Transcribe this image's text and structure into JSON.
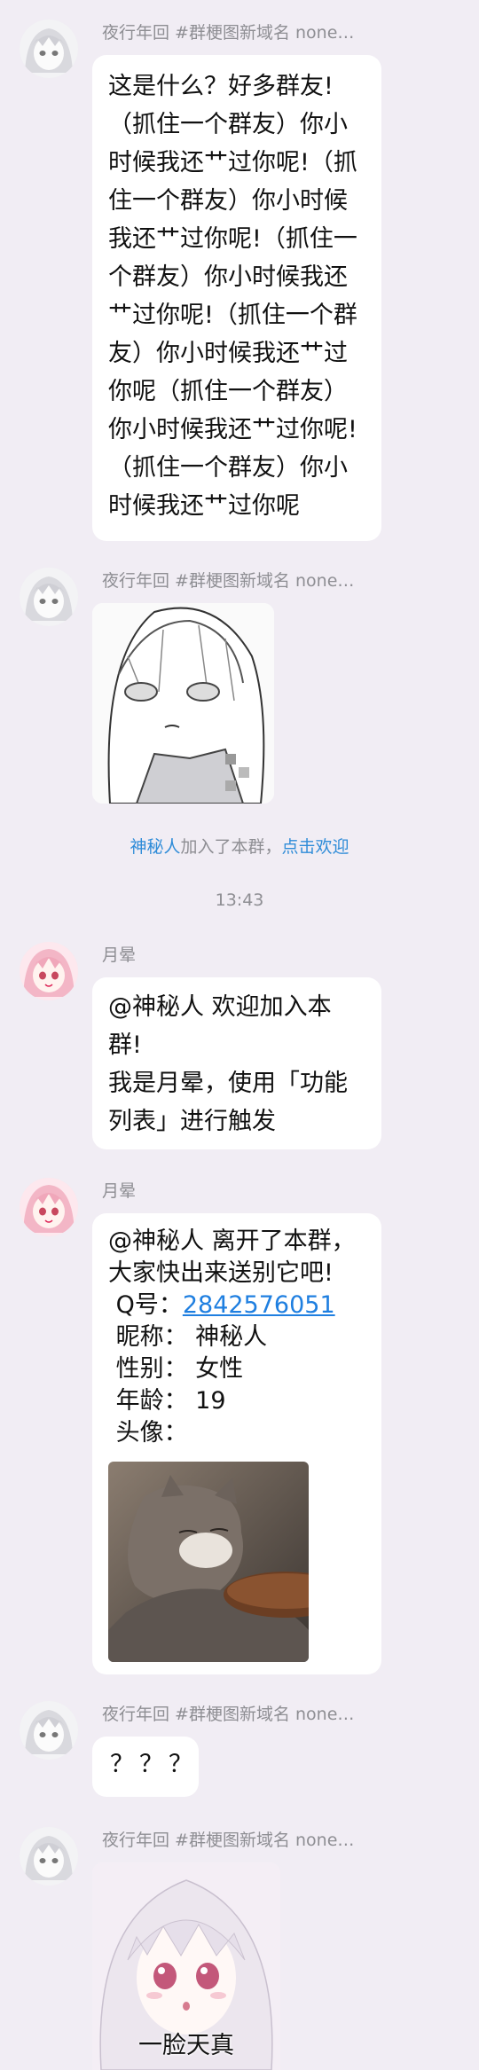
{
  "messages": [
    {
      "sender": "夜行年回 #群梗图新域名 none…",
      "text": "这是什么？好多群友!\n（抓住一个群友）你小\n时候我还艹过你呢!（抓\n住一个群友）你小时候\n我还艹过你呢!（抓住一\n个群友）你小时候我还\n艹过你呢!（抓住一个群\n友）你小时候我还艹过\n你呢（抓住一个群友）\n你小时候我还艹过你呢!\n（抓住一个群友）你小\n时候我还艹过你呢"
    },
    {
      "sender": "夜行年回 #群梗图新域名 none…"
    },
    {
      "sender": "月晕",
      "text": "@神秘人 欢迎加入本\n群!\n我是月晕，使用「功能\n列表」进行触发"
    },
    {
      "sender": "月晕",
      "leave_text": "@神秘人 离开了本群，\n大家快出来送别它吧!",
      "qq_label": " Q号：",
      "qq_value": "2842576051",
      "nick_line": " 昵称： 神秘人",
      "gender_line": " 性别： 女性",
      "age_line": " 年龄： 19",
      "avatar_line": " 头像："
    },
    {
      "sender": "夜行年回 #群梗图新域名 none…",
      "text": "？？？"
    },
    {
      "sender": "夜行年回 #群梗图新域名 none…",
      "sticker_caption": "一脸天真"
    }
  ],
  "system": {
    "joined_name": "神秘人",
    "joined_text": "加入了本群，",
    "welcome_link": "点击欢迎",
    "time": "13:43"
  },
  "colors": {
    "background": "#f1edf4",
    "bubble": "#ffffff",
    "link": "#2f8cd8"
  }
}
